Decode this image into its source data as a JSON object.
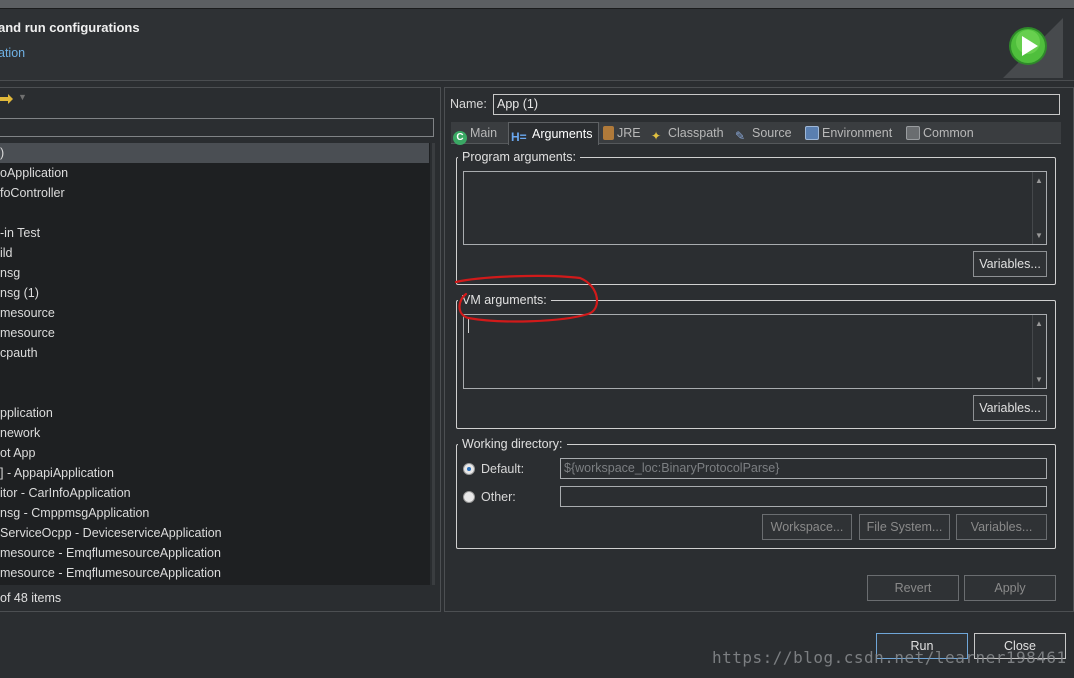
{
  "header": {
    "title": "and run configurations",
    "subtitle": "ation"
  },
  "left": {
    "filter_placeholder": "",
    "tree_items": [
      {
        "label": ")",
        "selected": true
      },
      {
        "label": "oApplication"
      },
      {
        "label": "foController"
      },
      {
        "label": ""
      },
      {
        "label": "-in Test"
      },
      {
        "label": "ild"
      },
      {
        "label": "nsg"
      },
      {
        "label": "nsg (1)"
      },
      {
        "label": "mesource"
      },
      {
        "label": "mesource"
      },
      {
        "label": "cpauth"
      },
      {
        "label": ""
      },
      {
        "label": ""
      },
      {
        "label": "pplication"
      },
      {
        "label": "nework"
      },
      {
        "label": "ot App"
      },
      {
        "label": "] - AppapiApplication"
      },
      {
        "label": "itor - CarInfoApplication"
      },
      {
        "label": "nsg - CmppmsgApplication"
      },
      {
        "label": "ServiceOcpp - DeviceserviceApplication"
      },
      {
        "label": "mesource - EmqflumesourceApplication"
      },
      {
        "label": "mesource - EmqflumesourceApplication"
      }
    ],
    "status": "of 48 items"
  },
  "right": {
    "name_label": "Name:",
    "name_value": "App (1)",
    "tabs": [
      "Main",
      "Arguments",
      "JRE",
      "Classpath",
      "Source",
      "Environment",
      "Common"
    ],
    "active_tab": "Arguments",
    "program_args_label": "Program arguments:",
    "program_args_value": "",
    "variables_label_1": "Variables...",
    "vm_args_label": "VM arguments:",
    "vm_args_value": "",
    "variables_label_2": "Variables...",
    "working_dir_label": "Working directory:",
    "default_label": "Default:",
    "default_value": "${workspace_loc:BinaryProtocolParse}",
    "other_label": "Other:",
    "other_value": "",
    "workspace_btn": "Workspace...",
    "filesystem_btn": "File System...",
    "variables_btn_3": "Variables...",
    "revert_btn": "Revert",
    "apply_btn": "Apply"
  },
  "footer": {
    "run_btn": "Run",
    "close_btn": "Close",
    "watermark": "https://blog.csdn.net/learner198461"
  },
  "colors": {
    "accent_red_annotation": "#d11a1a",
    "run_icon_green": "#3aa632",
    "link_blue": "#6fb1e4"
  },
  "icons": {
    "run_logo": "run-play-icon",
    "main_tab": "main-class-icon",
    "arguments_tab": "arguments-icon",
    "jre_tab": "jre-library-icon",
    "classpath_tab": "classpath-icon",
    "source_tab": "source-icon",
    "environment_tab": "environment-icon",
    "common_tab": "common-icon"
  }
}
